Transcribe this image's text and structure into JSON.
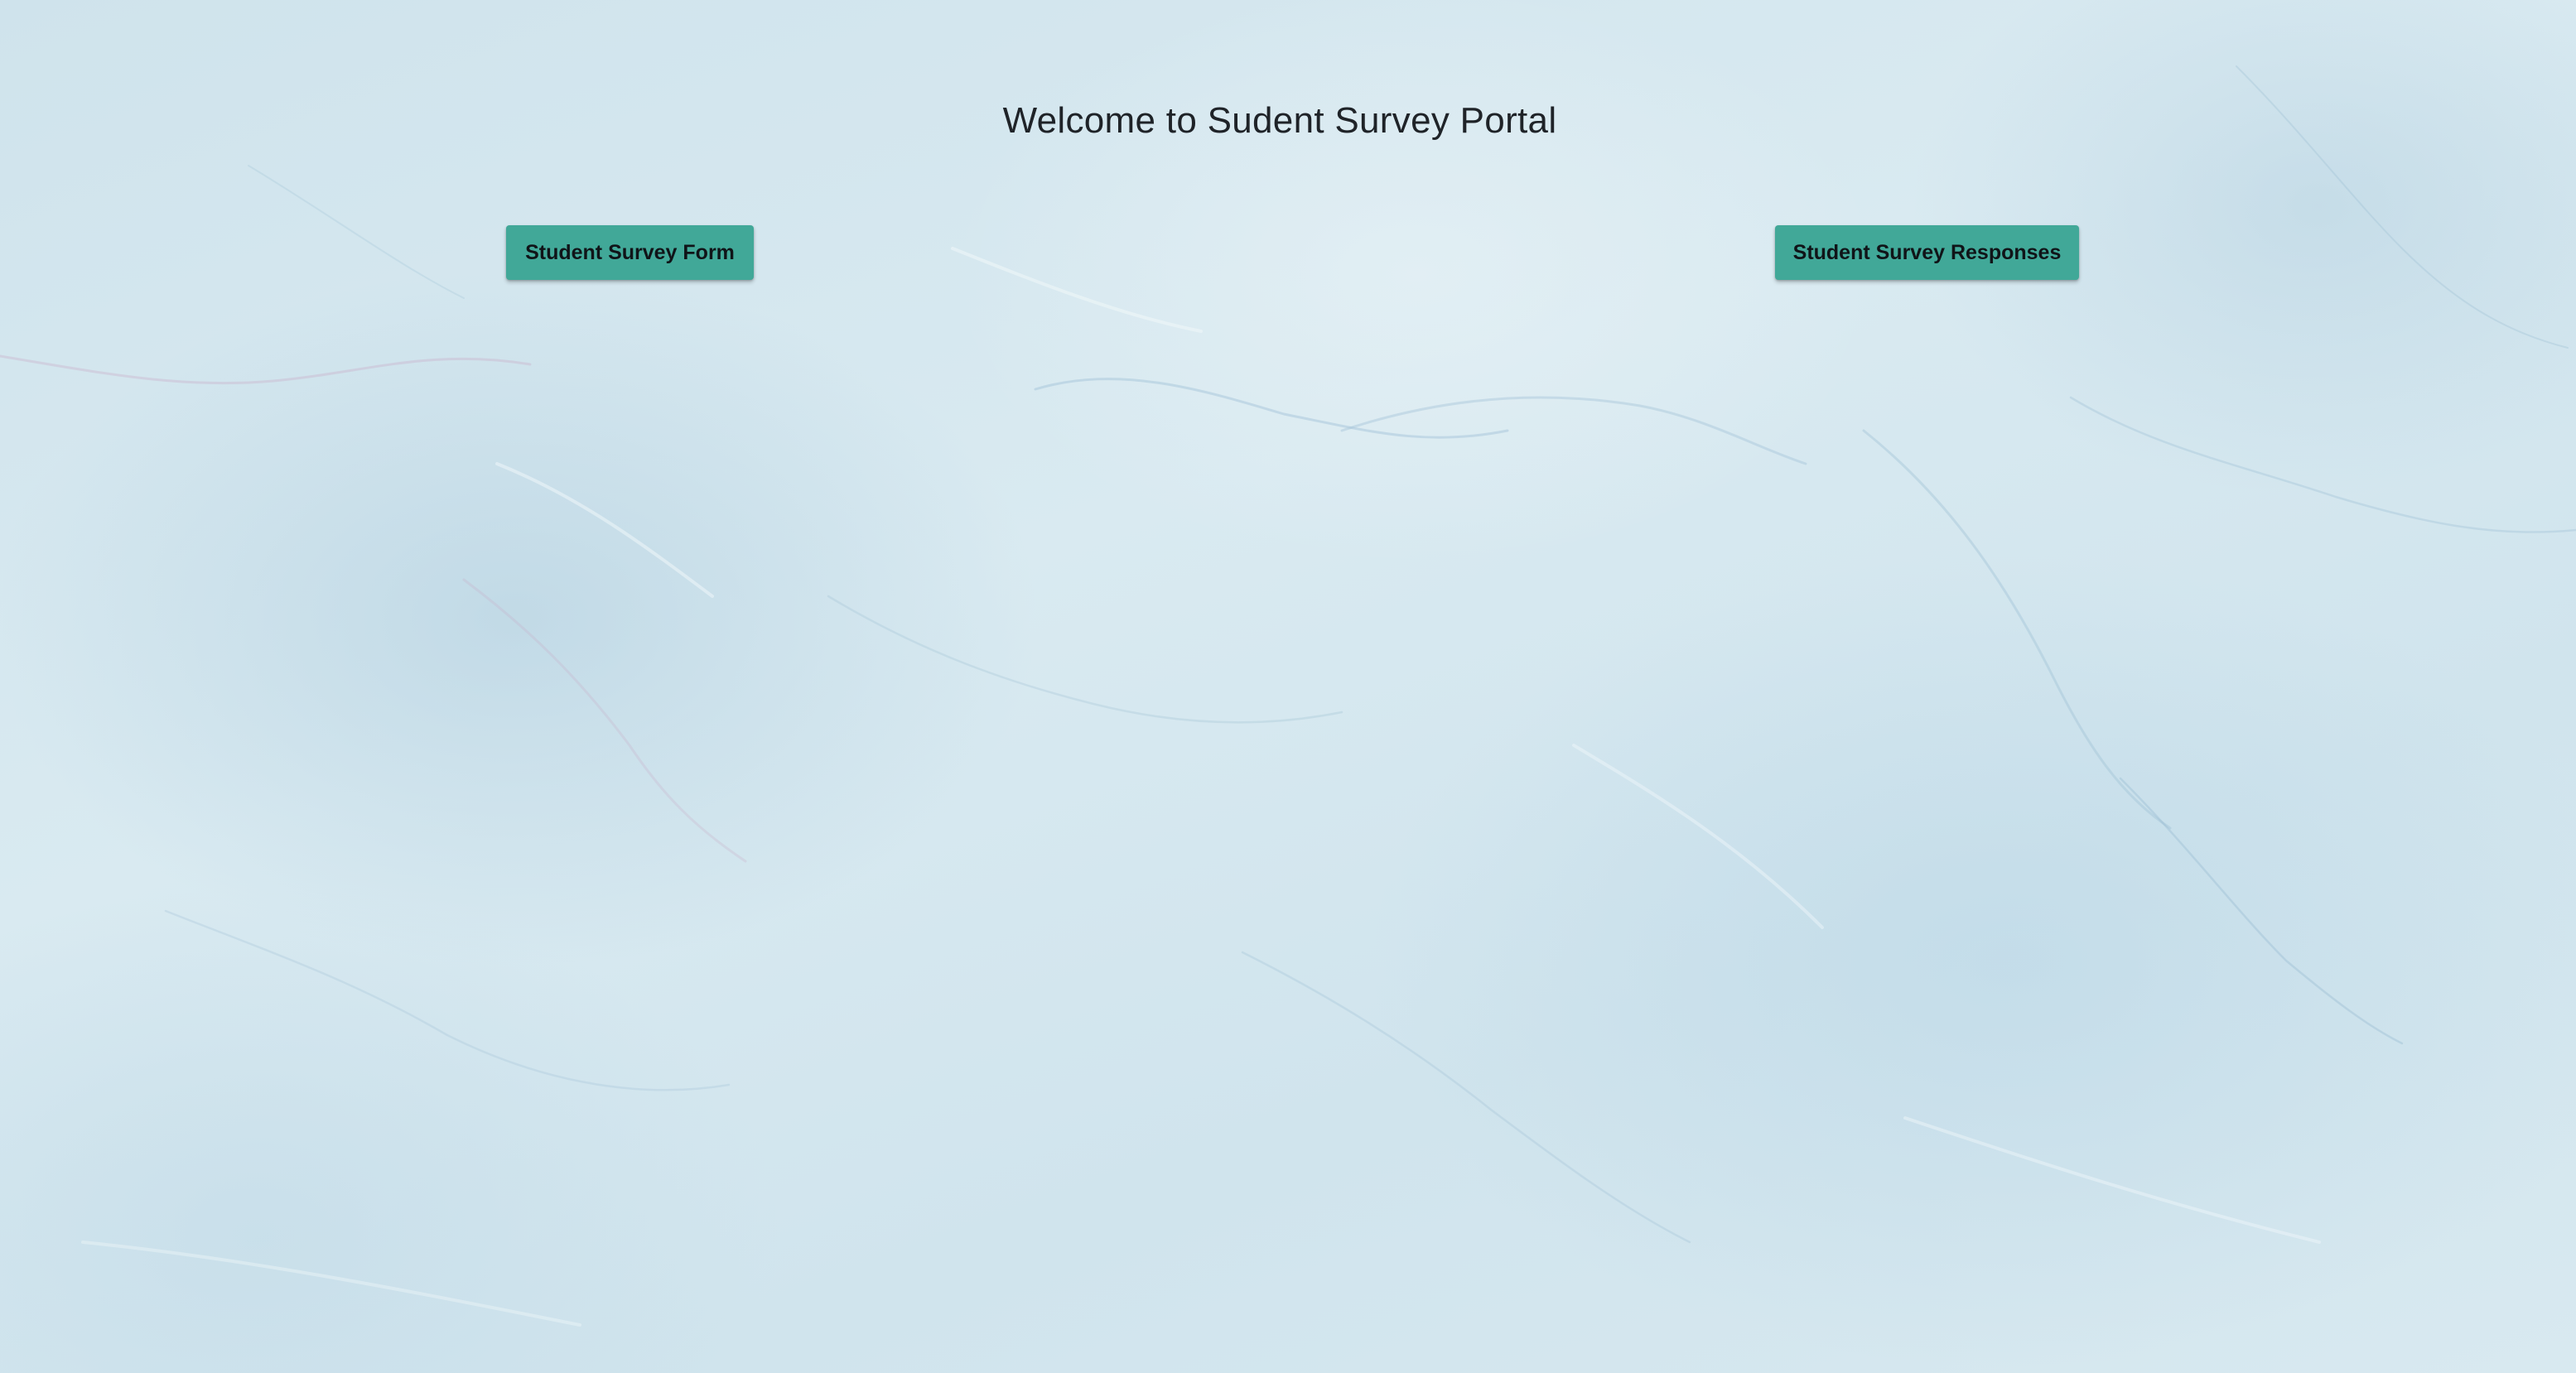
{
  "page": {
    "title": "Welcome to Sudent Survey Portal"
  },
  "nav": {
    "form_button": "Student Survey Form",
    "responses_button": "Student Survey Responses"
  },
  "colors": {
    "background": "#d3e6ee",
    "button": "#41a898",
    "button_text": "#101418",
    "title_text": "#1f2328"
  }
}
